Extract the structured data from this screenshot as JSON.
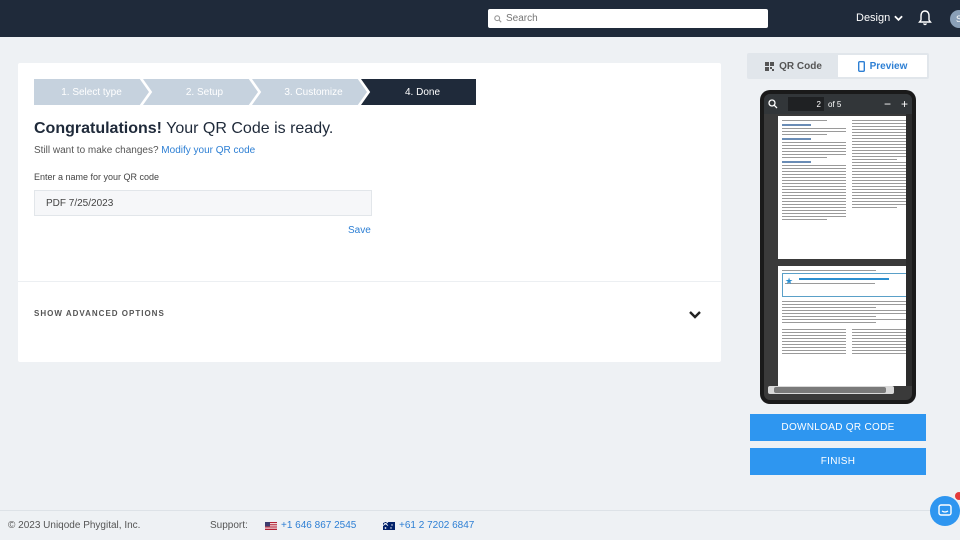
{
  "topbar": {
    "search_placeholder": "Search",
    "design_label": "Design",
    "avatar_initial": "S"
  },
  "steps": [
    {
      "label": "1. Select type",
      "state": "done"
    },
    {
      "label": "2. Setup",
      "state": "done"
    },
    {
      "label": "3. Customize",
      "state": "done"
    },
    {
      "label": "4. Done",
      "state": "active"
    }
  ],
  "main": {
    "congrats_bold": "Congratulations!",
    "congrats_rest": " Your QR Code is ready.",
    "modify_prefix": "Still want to make changes? ",
    "modify_link": "Modify your QR code",
    "name_label": "Enter a name for your QR code",
    "name_value": "PDF 7/25/2023",
    "save_label": "Save",
    "advanced_label": "SHOW ADVANCED OPTIONS"
  },
  "preview": {
    "tab_qr": "QR Code",
    "tab_preview": "Preview",
    "active_tab": "Preview",
    "page_current": "2",
    "page_of": "of 5"
  },
  "actions": {
    "download_label": "DOWNLOAD QR CODE",
    "finish_label": "FINISH"
  },
  "footer": {
    "copyright": "© 2023 Uniqode Phygital, Inc.",
    "support_label": "Support:",
    "phone_us": "+1 646 867 2545",
    "phone_au": "+61 2 7202 6847"
  },
  "colors": {
    "topbar": "#1f2a3a",
    "accent": "#2e96f0",
    "step_inactive": "#c6d2de",
    "link": "#2d7fd4"
  }
}
